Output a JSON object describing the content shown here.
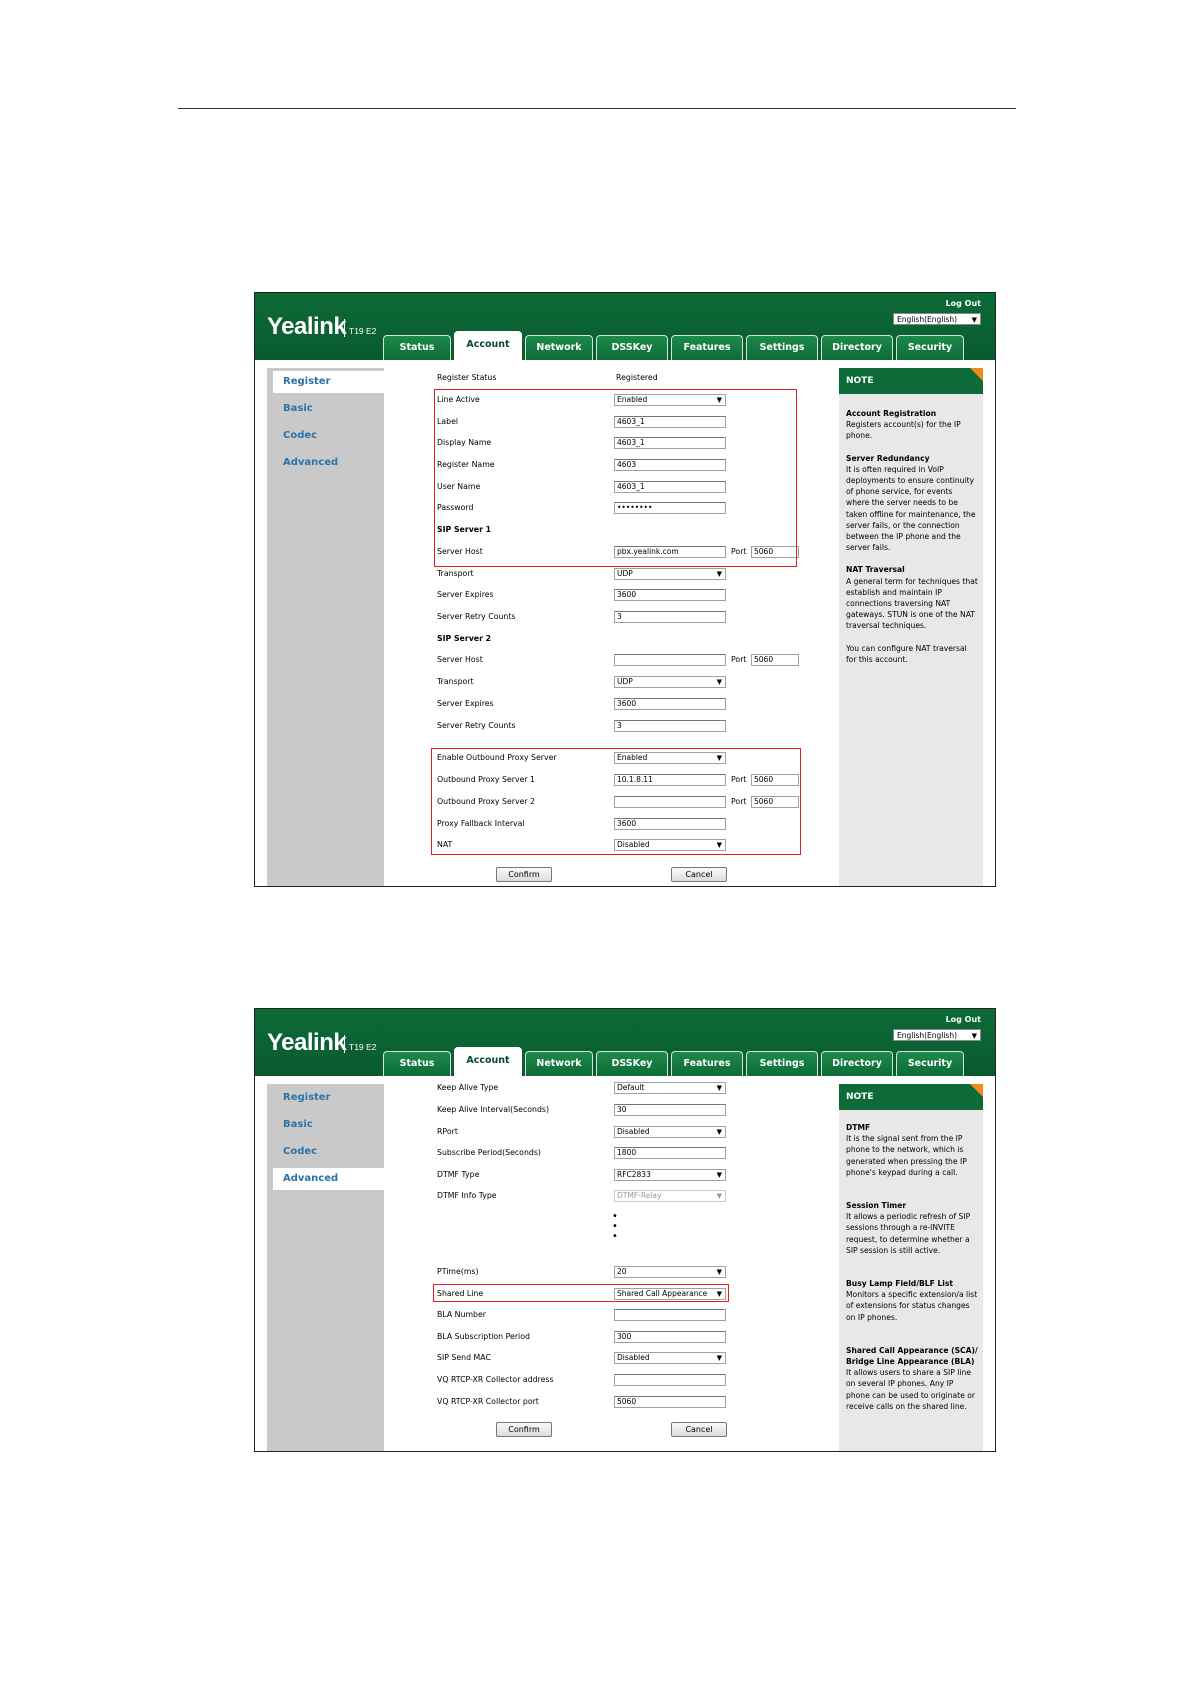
{
  "brand": {
    "logo": "Yealink",
    "model": "T19 E2"
  },
  "header": {
    "logout": "Log Out",
    "language": "English(English)"
  },
  "tabs": [
    "Status",
    "Account",
    "Network",
    "DSSKey",
    "Features",
    "Settings",
    "Directory",
    "Security"
  ],
  "active_tab": "Account",
  "sidebar": [
    "Register",
    "Basic",
    "Codec",
    "Advanced"
  ],
  "register_page": {
    "active_nav": "Register",
    "register_status_label": "Register Status",
    "register_status_value": "Registered",
    "line_active": {
      "label": "Line Active",
      "value": "Enabled"
    },
    "label": {
      "label": "Label",
      "value": "4603_1"
    },
    "display_name": {
      "label": "Display Name",
      "value": "4603_1"
    },
    "register_name": {
      "label": "Register Name",
      "value": "4603"
    },
    "user_name": {
      "label": "User Name",
      "value": "4603_1"
    },
    "password": {
      "label": "Password",
      "value": "••••••••"
    },
    "sip_server_1": "SIP Server 1",
    "s1_host": {
      "label": "Server Host",
      "value": "pbx.yealink.com",
      "port_label": "Port",
      "port": "5060"
    },
    "s1_transport": {
      "label": "Transport",
      "value": "UDP"
    },
    "s1_expires": {
      "label": "Server Expires",
      "value": "3600"
    },
    "s1_retry": {
      "label": "Server Retry Counts",
      "value": "3"
    },
    "sip_server_2": "SIP Server 2",
    "s2_host": {
      "label": "Server Host",
      "value": "",
      "port_label": "Port",
      "port": "5060"
    },
    "s2_transport": {
      "label": "Transport",
      "value": "UDP"
    },
    "s2_expires": {
      "label": "Server Expires",
      "value": "3600"
    },
    "s2_retry": {
      "label": "Server Retry Counts",
      "value": "3"
    },
    "outbound_enable": {
      "label": "Enable Outbound Proxy Server",
      "value": "Enabled"
    },
    "outbound_1": {
      "label": "Outbound Proxy Server 1",
      "value": "10.1.8.11",
      "port_label": "Port",
      "port": "5060"
    },
    "outbound_2": {
      "label": "Outbound Proxy Server 2",
      "value": "",
      "port_label": "Port",
      "port": "5060"
    },
    "fallback": {
      "label": "Proxy Fallback Interval",
      "value": "3600"
    },
    "nat": {
      "label": "NAT",
      "value": "Disabled"
    },
    "confirm": "Confirm",
    "cancel": "Cancel",
    "note": {
      "title": "NOTE",
      "items": [
        {
          "heading": "Account Registration",
          "text": "Registers account(s) for the IP phone."
        },
        {
          "heading": "Server Redundancy",
          "text": "It is often required in VoIP deployments to ensure continuity of phone service, for events where the server needs to be taken offline for maintenance, the server fails, or the connection between the IP phone and the server fails."
        },
        {
          "heading": "NAT Traversal",
          "text": "A general term for techniques that establish and maintain IP connections traversing NAT gateways. STUN is one of the NAT traversal techniques."
        },
        {
          "heading": "",
          "text": "You can configure NAT traversal for this account."
        }
      ]
    }
  },
  "advanced_page": {
    "active_nav": "Advanced",
    "keep_alive_type": {
      "label": "Keep Alive Type",
      "value": "Default"
    },
    "keep_alive_interval": {
      "label": "Keep Alive Interval(Seconds)",
      "value": "30"
    },
    "rport": {
      "label": "RPort",
      "value": "Disabled"
    },
    "subscribe_period": {
      "label": "Subscribe Period(Seconds)",
      "value": "1800"
    },
    "dtmf_type": {
      "label": "DTMF Type",
      "value": "RFC2833"
    },
    "dtmf_info_type": {
      "label": "DTMF Info Type",
      "value": "DTMF-Relay"
    },
    "ptime": {
      "label": "PTime(ms)",
      "value": "20"
    },
    "shared_line": {
      "label": "Shared Line",
      "value": "Shared Call Appearance"
    },
    "bla_number": {
      "label": "BLA Number",
      "value": ""
    },
    "bla_sub_period": {
      "label": "BLA Subscription Period",
      "value": "300"
    },
    "sip_send_mac": {
      "label": "SIP Send MAC",
      "value": "Disabled"
    },
    "vq_addr": {
      "label": "VQ RTCP-XR Collector address",
      "value": ""
    },
    "vq_port": {
      "label": "VQ RTCP-XR Collector port",
      "value": "5060"
    },
    "confirm": "Confirm",
    "cancel": "Cancel",
    "note": {
      "title": "NOTE",
      "items": [
        {
          "heading": "DTMF",
          "text": "It is the signal sent from the IP phone to the network, which is generated when pressing the IP phone's keypad during a call."
        },
        {
          "heading": "Session Timer",
          "text": "It allows a periodic refresh of SIP sessions through a re-INVITE request, to determine whether a SIP session is still active."
        },
        {
          "heading": "Busy Lamp Field/BLF List",
          "text": "Monitors a specific extension/a list of extensions for status changes on IP phones."
        },
        {
          "heading": "Shared Call Appearance (SCA)/ Bridge Line Appearance (BLA)",
          "text": "It allows users to share a SIP line on several IP phones. Any IP phone can be used to originate or receive calls on the shared line."
        }
      ]
    }
  }
}
